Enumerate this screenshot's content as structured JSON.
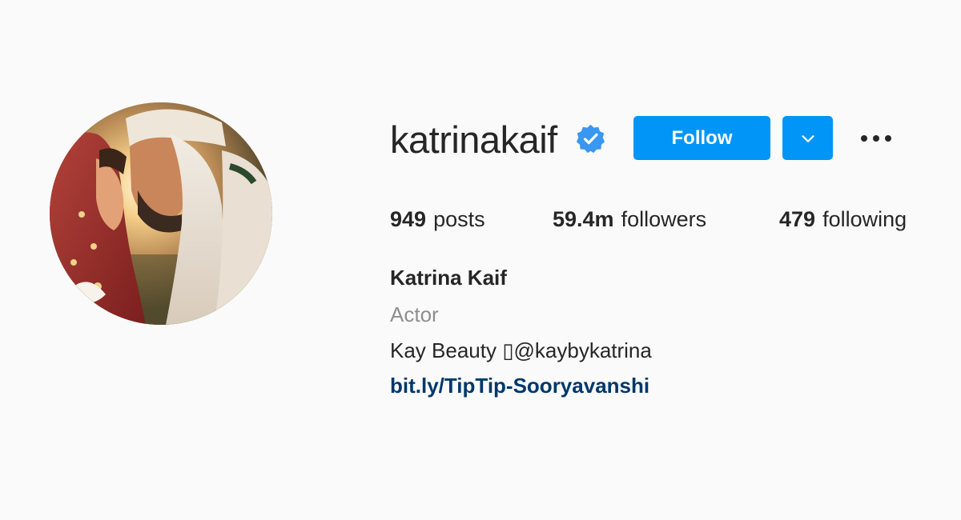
{
  "profile": {
    "username": "katrinakaif",
    "verified_icon": "verified-badge-icon",
    "follow_label": "Follow",
    "dropdown_icon": "chevron-down-icon",
    "more_icon": "more-options-icon",
    "avatar_icon": "profile-photo"
  },
  "stats": {
    "posts_count": "949",
    "posts_label": "posts",
    "followers_count": "59.4m",
    "followers_label": "followers",
    "following_count": "479",
    "following_label": "following"
  },
  "bio": {
    "full_name": "Katrina Kaif",
    "category": "Actor",
    "line1": "Kay Beauty ▯@kaybykatrina",
    "link": "bit.ly/TipTip-Sooryavanshi"
  },
  "colors": {
    "background": "#fafafa",
    "primary_button": "#0095f6",
    "link": "#00376b",
    "muted_text": "#8e8e8e",
    "verified": "#3897f0"
  }
}
